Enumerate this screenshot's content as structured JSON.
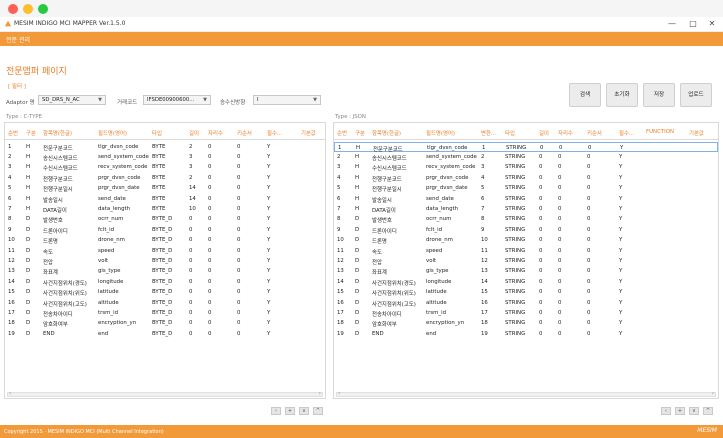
{
  "window": {
    "title": "MESIM INDIGO MCI MAPPER Ver.1.5.0",
    "minimize": "—",
    "maximize": "□",
    "close": "✕"
  },
  "menubar": {
    "menu": "전문 관리"
  },
  "page": {
    "title": "전문맵퍼 페이지",
    "section_tag": "[ 필터 ]"
  },
  "filters": {
    "adaptor_label": "Adaptor 명",
    "adaptor_value": "SD_DRS_N_AC",
    "trade_label": "거래코드",
    "trade_value": "IFSDE00900600...",
    "direction_label": "송수신방향",
    "direction_value": "I"
  },
  "actions": {
    "search": "검색",
    "reset": "초기화",
    "save": "저장",
    "upload": "업로드"
  },
  "left_table": {
    "type_label": "Type :  C-TYPE",
    "headers": [
      "순번",
      "구분",
      "항목명(한글)",
      "필드명(영어)",
      "타입",
      "길이",
      "자리수",
      "키순서",
      "필수...",
      "기본값"
    ],
    "rows": [
      [
        "1",
        "H",
        "전문구분코드",
        "tlgr_dvsn_code",
        "BYTE",
        "2",
        "0",
        "0",
        "Y",
        ""
      ],
      [
        "2",
        "H",
        "송신시스템코드",
        "send_system_code",
        "BYTE",
        "3",
        "0",
        "0",
        "Y",
        ""
      ],
      [
        "3",
        "H",
        "수신시스템코드",
        "recv_system_code",
        "BYTE",
        "3",
        "0",
        "0",
        "Y",
        ""
      ],
      [
        "4",
        "H",
        "전행구분코드",
        "prgr_dvsn_code",
        "BYTE",
        "2",
        "0",
        "0",
        "Y",
        ""
      ],
      [
        "5",
        "H",
        "전행구분일시",
        "prgr_dvsn_date",
        "BYTE",
        "14",
        "0",
        "0",
        "Y",
        ""
      ],
      [
        "6",
        "H",
        "발송일시",
        "send_date",
        "BYTE",
        "14",
        "0",
        "0",
        "Y",
        ""
      ],
      [
        "7",
        "H",
        "DATA길이",
        "data_length",
        "BYTE",
        "10",
        "0",
        "0",
        "Y",
        ""
      ],
      [
        "8",
        "D",
        "발생번호",
        "ocrr_num",
        "BYTE_D",
        "0",
        "0",
        "0",
        "Y",
        ""
      ],
      [
        "9",
        "D",
        "드론아이디",
        "fclt_id",
        "BYTE_D",
        "0",
        "0",
        "0",
        "Y",
        ""
      ],
      [
        "10",
        "D",
        "드론명",
        "drone_nm",
        "BYTE_D",
        "0",
        "0",
        "0",
        "Y",
        ""
      ],
      [
        "11",
        "D",
        "속도",
        "speed",
        "BYTE_D",
        "0",
        "0",
        "0",
        "Y",
        ""
      ],
      [
        "12",
        "D",
        "전압",
        "volt",
        "BYTE_D",
        "0",
        "0",
        "0",
        "Y",
        ""
      ],
      [
        "13",
        "D",
        "좌표계",
        "gis_type",
        "BYTE_D",
        "0",
        "0",
        "0",
        "Y",
        ""
      ],
      [
        "14",
        "D",
        "사건지점위치(경도)",
        "longitude",
        "BYTE_D",
        "0",
        "0",
        "0",
        "Y",
        ""
      ],
      [
        "15",
        "D",
        "사건지점위치(위도)",
        "latitude",
        "BYTE_D",
        "0",
        "0",
        "0",
        "Y",
        ""
      ],
      [
        "16",
        "D",
        "사건지점위치(고도)",
        "altitude",
        "BYTE_D",
        "0",
        "0",
        "0",
        "Y",
        ""
      ],
      [
        "17",
        "D",
        "전송차아이디",
        "trsm_id",
        "BYTE_D",
        "0",
        "0",
        "0",
        "Y",
        ""
      ],
      [
        "18",
        "D",
        "암호화여부",
        "encryption_yn",
        "BYTE_D",
        "0",
        "0",
        "0",
        "Y",
        ""
      ],
      [
        "19",
        "D",
        "END",
        "end",
        "BYTE_D",
        "0",
        "0",
        "0",
        "Y",
        ""
      ]
    ]
  },
  "right_table": {
    "type_label": "Type :  JSON",
    "headers": [
      "순번",
      "구분",
      "항목명(한글)",
      "필드명(영어)",
      "변환...",
      "타입",
      "길이",
      "자리수",
      "키순서",
      "필수...",
      "FUNCTION",
      "기본값"
    ],
    "rows": [
      [
        "1",
        "H",
        "전문구분코드",
        "tlgr_dvsn_code",
        "1",
        "STRING",
        "0",
        "0",
        "0",
        "Y",
        "",
        ""
      ],
      [
        "2",
        "H",
        "송신시스템코드",
        "send_system_code",
        "2",
        "STRING",
        "0",
        "0",
        "0",
        "Y",
        "",
        ""
      ],
      [
        "3",
        "H",
        "수신시스템코드",
        "recv_system_code",
        "3",
        "STRING",
        "0",
        "0",
        "0",
        "Y",
        "",
        ""
      ],
      [
        "4",
        "H",
        "전행구분코드",
        "prgr_dvsn_code",
        "4",
        "STRING",
        "0",
        "0",
        "0",
        "Y",
        "",
        ""
      ],
      [
        "5",
        "H",
        "전행구분일시",
        "prgr_dvsn_date",
        "5",
        "STRING",
        "0",
        "0",
        "0",
        "Y",
        "",
        ""
      ],
      [
        "6",
        "H",
        "발송일시",
        "send_date",
        "6",
        "STRING",
        "0",
        "0",
        "0",
        "Y",
        "",
        ""
      ],
      [
        "7",
        "H",
        "DATA길이",
        "data_length",
        "7",
        "STRING",
        "0",
        "0",
        "0",
        "Y",
        "",
        ""
      ],
      [
        "8",
        "D",
        "발생번호",
        "ocrr_num",
        "8",
        "STRING",
        "0",
        "0",
        "0",
        "Y",
        "",
        ""
      ],
      [
        "9",
        "D",
        "드론아이디",
        "fclt_id",
        "9",
        "STRING",
        "0",
        "0",
        "0",
        "Y",
        "",
        ""
      ],
      [
        "10",
        "D",
        "드론명",
        "drone_nm",
        "10",
        "STRING",
        "0",
        "0",
        "0",
        "Y",
        "",
        ""
      ],
      [
        "11",
        "D",
        "속도",
        "speed",
        "11",
        "STRING",
        "0",
        "0",
        "0",
        "Y",
        "",
        ""
      ],
      [
        "12",
        "D",
        "전압",
        "volt",
        "12",
        "STRING",
        "0",
        "0",
        "0",
        "Y",
        "",
        ""
      ],
      [
        "13",
        "D",
        "좌표계",
        "gis_type",
        "13",
        "STRING",
        "0",
        "0",
        "0",
        "Y",
        "",
        ""
      ],
      [
        "14",
        "D",
        "사건지점위치(경도)",
        "longitude",
        "14",
        "STRING",
        "0",
        "0",
        "0",
        "Y",
        "",
        ""
      ],
      [
        "15",
        "D",
        "사건지점위치(위도)",
        "latitude",
        "15",
        "STRING",
        "0",
        "0",
        "0",
        "Y",
        "",
        ""
      ],
      [
        "16",
        "D",
        "사건지점위치(고도)",
        "altitude",
        "16",
        "STRING",
        "0",
        "0",
        "0",
        "Y",
        "",
        ""
      ],
      [
        "17",
        "D",
        "전송차아이디",
        "trsm_id",
        "17",
        "STRING",
        "0",
        "0",
        "0",
        "Y",
        "",
        ""
      ],
      [
        "18",
        "D",
        "암호화여부",
        "encryption_yn",
        "18",
        "STRING",
        "0",
        "0",
        "0",
        "Y",
        "",
        ""
      ],
      [
        "19",
        "D",
        "END",
        "end",
        "19",
        "STRING",
        "0",
        "0",
        "0",
        "Y",
        "",
        ""
      ]
    ],
    "selected_row": 1
  },
  "pager": [
    "‹",
    "+",
    "∨",
    "^"
  ],
  "footer": {
    "copyright": "Copyright 2015 · MESIM INDIGO MCI (Multi Channel Integration)",
    "brand": "MESIM"
  },
  "colors": {
    "accent": "#f29a3a",
    "header_text": "#e87d28",
    "selection": "#7fb3e6"
  }
}
